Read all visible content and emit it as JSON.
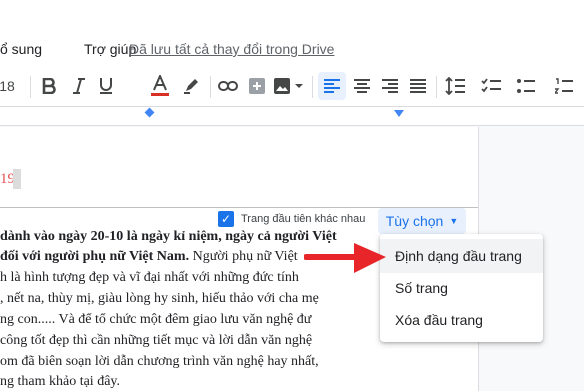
{
  "menu": {
    "items": [
      "ổ sung",
      "Trợ giúp"
    ],
    "saved_status": "Đã lưu tất cả thay đổi trong Drive"
  },
  "toolbar": {
    "font_size_fragment": "18",
    "icons": [
      "bold-icon",
      "italic-icon",
      "underline-icon",
      "text-color-icon",
      "highlight-icon",
      "link-icon",
      "comment-icon",
      "image-icon",
      "align-left-icon",
      "align-center-icon",
      "align-right-icon",
      "justify-icon",
      "line-spacing-icon",
      "checklist-icon"
    ],
    "active": "align-left-icon",
    "text_color_accent": "#d93025"
  },
  "header": {
    "page_number_text": "19",
    "checkbox_checked": true,
    "checkbox_label": "Trang đầu tiên khác nhau",
    "options_label": "Tùy chọn"
  },
  "body_lines": [
    "dành vào ngày 20-10 là ngày kỉ niệm, ngày cả người Việt",
    "đối với người phụ nữ Việt Nam. Người phụ nữ Việt",
    "h là hình tượng đẹp và vĩ đại nhất với những đức tính",
    ", nết na, thùy mị, giàu lòng hy sinh, hiếu thảo với cha mẹ",
    "ng con..... Và để tổ chức một đêm giao lưu văn nghệ đư",
    "công tốt đẹp thì cần những tiết mục và lời dẫn văn nghệ",
    "om đã biên soạn lời dẫn chương trình văn nghệ hay nhất,",
    "ng tham khảo tại đây."
  ],
  "dropdown": {
    "items": [
      "Định dạng đầu trang",
      "Số trang",
      "Xóa đầu trang"
    ],
    "highlighted_index": 0
  },
  "colors": {
    "accent": "#1a73e8",
    "arrow": "#e8262a"
  }
}
